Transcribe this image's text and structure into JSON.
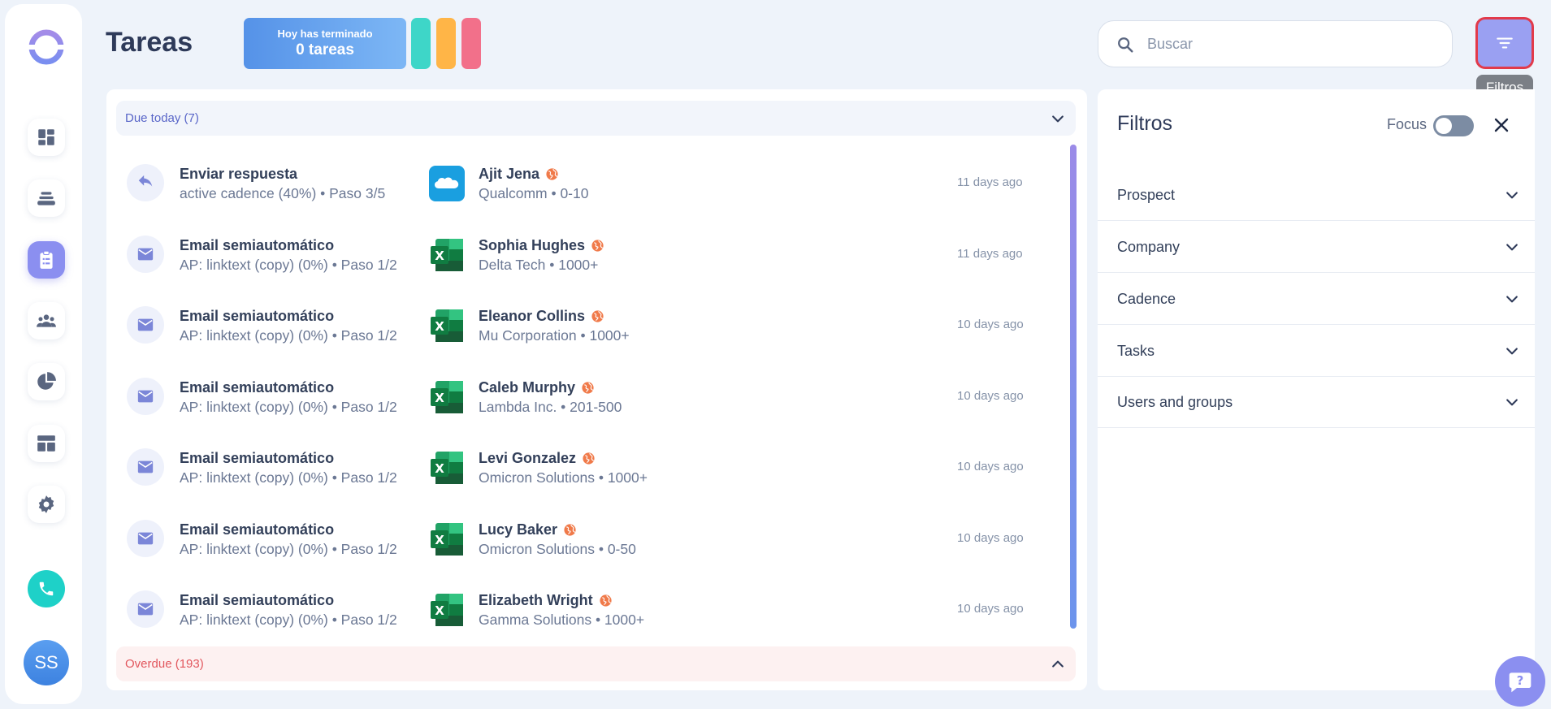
{
  "header": {
    "title": "Tareas",
    "done_label": "Hoy has terminado",
    "done_value": "0 tareas",
    "pill_colors": [
      "#3ed6c8",
      "#ffb547",
      "#f2708a"
    ]
  },
  "search": {
    "placeholder": "Buscar",
    "value": ""
  },
  "filter_button": {
    "icon": "filter-lines-icon",
    "tooltip": "Filtros"
  },
  "sidebar": {
    "items": [
      {
        "name": "dashboard",
        "icon": "dashboard-icon",
        "active": false
      },
      {
        "name": "inbox",
        "icon": "layers-icon",
        "active": false
      },
      {
        "name": "tasks",
        "icon": "clipboard-icon",
        "active": true
      },
      {
        "name": "prospects",
        "icon": "people-icon",
        "active": false
      },
      {
        "name": "reports",
        "icon": "pie-chart-icon",
        "active": false
      },
      {
        "name": "templates",
        "icon": "layout-icon",
        "active": false
      },
      {
        "name": "settings",
        "icon": "gear-icon",
        "active": false
      }
    ],
    "phone_icon": "phone-icon",
    "avatar_initials": "SS"
  },
  "groups": {
    "today": {
      "label": "Due today (7)",
      "expanded": true
    },
    "overdue": {
      "label": "Overdue (193)",
      "expanded": false
    }
  },
  "tasks": [
    {
      "type": "reply",
      "title": "Enviar respuesta",
      "subtitle": "active cadence (40%) • Paso 3/5",
      "source": "salesforce",
      "prospect": "Ajit Jena",
      "company": "Qualcomm • 0-10",
      "time": "11 days ago"
    },
    {
      "type": "email",
      "title": "Email semiautomático",
      "subtitle": "AP: linktext (copy) (0%) • Paso 1/2",
      "source": "excel",
      "prospect": "Sophia Hughes",
      "company": "Delta Tech • 1000+",
      "time": "11 days ago"
    },
    {
      "type": "email",
      "title": "Email semiautomático",
      "subtitle": "AP: linktext (copy) (0%) • Paso 1/2",
      "source": "excel",
      "prospect": "Eleanor Collins",
      "company": "Mu Corporation • 1000+",
      "time": "10 days ago"
    },
    {
      "type": "email",
      "title": "Email semiautomático",
      "subtitle": "AP: linktext (copy) (0%) • Paso 1/2",
      "source": "excel",
      "prospect": "Caleb Murphy",
      "company": "Lambda Inc. • 201-500",
      "time": "10 days ago"
    },
    {
      "type": "email",
      "title": "Email semiautomático",
      "subtitle": "AP: linktext (copy) (0%) • Paso 1/2",
      "source": "excel",
      "prospect": "Levi Gonzalez",
      "company": "Omicron Solutions • 1000+",
      "time": "10 days ago"
    },
    {
      "type": "email",
      "title": "Email semiautomático",
      "subtitle": "AP: linktext (copy) (0%) • Paso 1/2",
      "source": "excel",
      "prospect": "Lucy Baker",
      "company": "Omicron Solutions • 0-50",
      "time": "10 days ago"
    },
    {
      "type": "email",
      "title": "Email semiautomático",
      "subtitle": "AP: linktext (copy) (0%) • Paso 1/2",
      "source": "excel",
      "prospect": "Elizabeth Wright",
      "company": "Gamma Solutions • 1000+",
      "time": "10 days ago"
    }
  ],
  "filters": {
    "title": "Filtros",
    "focus_label": "Focus",
    "focus_on": false,
    "sections": [
      "Prospect",
      "Company",
      "Cadence",
      "Tasks",
      "Users and groups"
    ]
  },
  "colors": {
    "accent": "#8b8ff0",
    "link": "#5865c8",
    "overdue": "#e2575e",
    "globe": "#f07a4a"
  }
}
